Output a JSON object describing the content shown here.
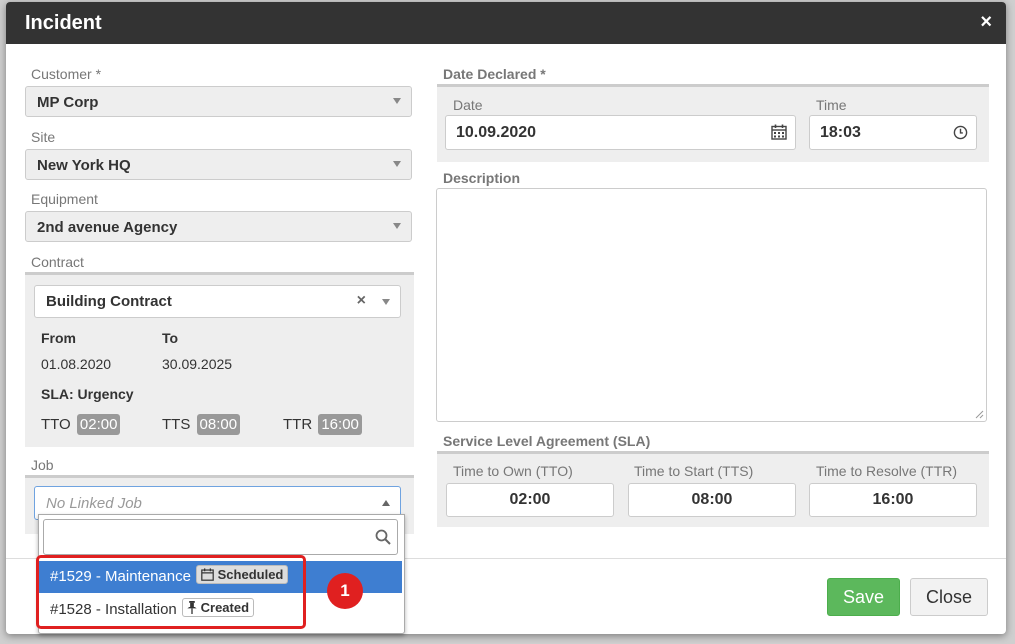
{
  "modal": {
    "title": "Incident",
    "close_symbol": "×"
  },
  "customer": {
    "label": "Customer *",
    "value": "MP Corp"
  },
  "site": {
    "label": "Site",
    "value": "New York HQ"
  },
  "equipment": {
    "label": "Equipment",
    "value": "2nd avenue Agency"
  },
  "contract": {
    "label": "Contract",
    "value": "Building Contract",
    "from_label": "From",
    "from_value": "01.08.2020",
    "to_label": "To",
    "to_value": "30.09.2025",
    "sla_label": "SLA: Urgency",
    "tto_label": "TTO",
    "tto_value": "02:00",
    "tts_label": "TTS",
    "tts_value": "08:00",
    "ttr_label": "TTR",
    "ttr_value": "16:00"
  },
  "job": {
    "label": "Job",
    "placeholder": "No Linked Job",
    "options": [
      {
        "label": "#1529 - Maintenance",
        "status": "Scheduled"
      },
      {
        "label": "#1528 - Installation",
        "status": "Created"
      }
    ]
  },
  "date_declared": {
    "label": "Date Declared *",
    "date_label": "Date",
    "date_value": "10.09.2020",
    "time_label": "Time",
    "time_value": "18:03"
  },
  "description": {
    "label": "Description"
  },
  "sla": {
    "label": "Service Level Agreement (SLA)",
    "tto_label": "Time to Own (TTO)",
    "tto_value": "02:00",
    "tts_label": "Time to Start (TTS)",
    "tts_value": "08:00",
    "ttr_label": "Time to Resolve (TTR)",
    "ttr_value": "16:00"
  },
  "annotation_number": "1",
  "buttons": {
    "save": "Save",
    "close": "Close"
  },
  "colors": {
    "header": "#333333",
    "save": "#5cb85c",
    "highlight": "#3e7ed1",
    "callout": "#e02020"
  }
}
